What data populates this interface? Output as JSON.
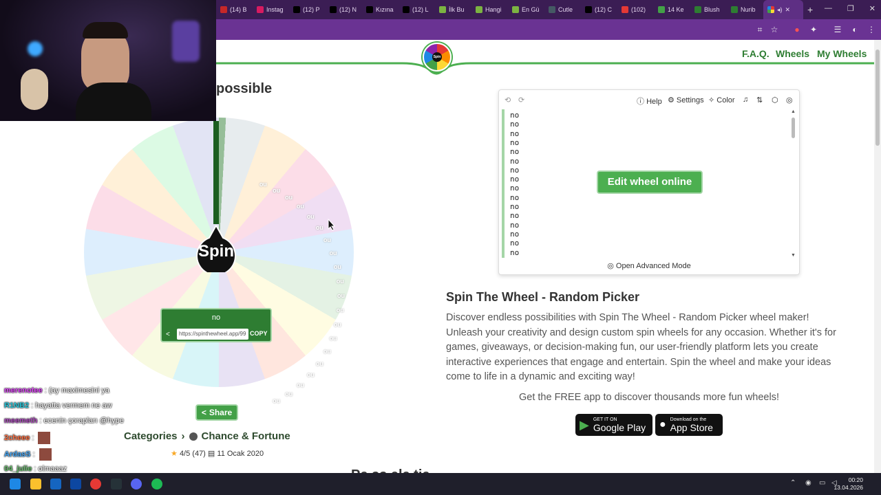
{
  "browser": {
    "tabs": [
      {
        "label": "(14) B",
        "color": "#c62828"
      },
      {
        "label": "Instag",
        "color": "#d81b60"
      },
      {
        "label": "(12) P",
        "color": "#000000"
      },
      {
        "label": "(12) N",
        "color": "#000000"
      },
      {
        "label": "Kızına",
        "color": "#000000"
      },
      {
        "label": "(12) L",
        "color": "#000000"
      },
      {
        "label": "İlk Bu",
        "color": "#7cb342"
      },
      {
        "label": "Hangi",
        "color": "#7cb342"
      },
      {
        "label": "En Gü",
        "color": "#7cb342"
      },
      {
        "label": "Cutle",
        "color": "#455a64"
      },
      {
        "label": "(12) C",
        "color": "#000000"
      },
      {
        "label": "(102)",
        "color": "#e53935"
      },
      {
        "label": "14 Ke",
        "color": "#43a047"
      },
      {
        "label": "Blush",
        "color": "#2e7d32"
      },
      {
        "label": "Nurib",
        "color": "#2e7d32"
      }
    ],
    "new_tab": "+"
  },
  "nav": {
    "faq": "F.A.Q.",
    "wheels": "Wheels",
    "my_wheels": "My Wheels",
    "logo_text": "Spin"
  },
  "heading_fragment": "possible",
  "wheel": {
    "labels": [
      "ou",
      "ou",
      "ou",
      "ou",
      "ou",
      "ou",
      "ou",
      "ou",
      "ou",
      "ou",
      "ou",
      "ou",
      "ou",
      "ou",
      "ou",
      "ou",
      "ou",
      "ou",
      "ou",
      "ou"
    ],
    "spin_label": "Spin",
    "result_text": "no",
    "result_url": "https://spinthewheel.app/99",
    "copy_label": "COPY"
  },
  "share_label": "Share",
  "categories": {
    "label": "Categories",
    "separator": "›",
    "value": "Chance & Fortune"
  },
  "rating": {
    "stars": "★",
    "text": "4/5 (47)",
    "date_icon": "▤",
    "date": "11 Ocak 2020"
  },
  "editor": {
    "tools": {
      "help": "Help",
      "settings": "Settings",
      "color": "Color"
    },
    "entries": [
      "no",
      "no",
      "no",
      "no",
      "no",
      "no",
      "no",
      "no",
      "no",
      "no",
      "no",
      "no",
      "no",
      "no",
      "no",
      "no"
    ],
    "edit_online": "Edit wheel online",
    "advanced": "Open Advanced Mode"
  },
  "content": {
    "title": "Spin The Wheel - Random Picker",
    "description": "Discover endless possibilities with Spin The Wheel - Random Picker wheel maker! Unleash your creativity and design custom spin wheels for any occasion. Whether it's for games, giveaways, or decision-making fun, our user-friendly platform lets you create interactive experiences that engage and entertain. Spin the wheel and make your ideas come to life in a dynamic and exciting way!",
    "free_app": "Get the FREE app to discover thousands more fun wheels!",
    "google_small": "GET IT ON",
    "google_big": "Google Play",
    "apple_small": "Download on the",
    "apple_big": "App Store",
    "bottom_heading": "Pe        ss   ele  tie"
  },
  "chat": [
    {
      "user": "merenotee",
      "color": "#e040fb",
      "message": ": (ay maximesini ya"
    },
    {
      "user": "R1NB2",
      "color": "#26c6da",
      "message": ": hayatta vermem ne aw"
    },
    {
      "user": "meemeth",
      "color": "#ab47bc",
      "message": ": ecenin çorapları @hype"
    },
    {
      "user": "2cheee",
      "color": "#ff7043",
      "message": ":"
    },
    {
      "user": "ArdasS",
      "color": "#42a5f5",
      "message": ":"
    },
    {
      "user": "04_julie",
      "color": "#66bb6a",
      "message": ": olmaaaz"
    }
  ],
  "clock": {
    "time": "00:20",
    "date": "13.04.2026"
  }
}
